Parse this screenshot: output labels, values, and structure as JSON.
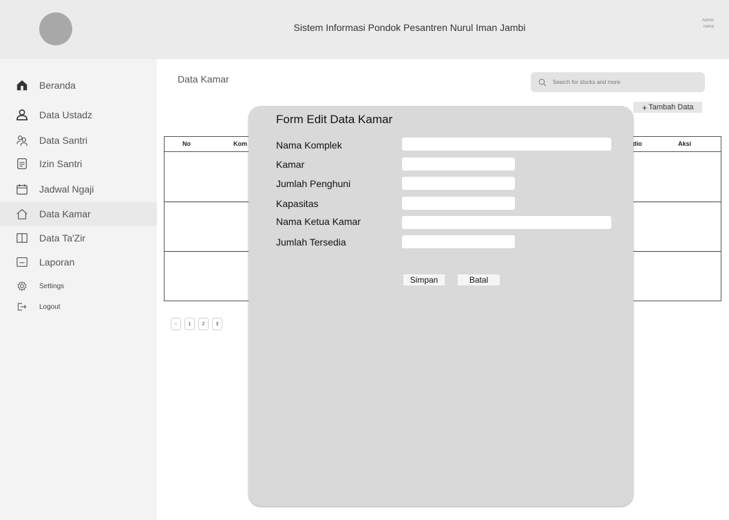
{
  "header": {
    "title": "Sistem Informasi Pondok Pesantren Nurul Iman Jambi",
    "admin_name": "Admin",
    "admin_sub": "nama"
  },
  "sidebar": {
    "items": [
      {
        "label": "Beranda",
        "icon": "home-icon"
      },
      {
        "label": "Data Ustadz",
        "icon": "user-icon"
      },
      {
        "label": "Data Santri",
        "icon": "users-icon"
      },
      {
        "label": "Izin Santri",
        "icon": "document-icon"
      },
      {
        "label": "Jadwal Ngaji",
        "icon": "calendar-icon"
      },
      {
        "label": "Data Kamar",
        "icon": "house-outline-icon"
      },
      {
        "label": "Data Ta'Zir",
        "icon": "book-icon"
      },
      {
        "label": "Laporan",
        "icon": "report-icon"
      },
      {
        "label": "Settings",
        "icon": "gear-icon"
      },
      {
        "label": "Logout",
        "icon": "logout-icon"
      }
    ]
  },
  "main": {
    "page_title": "Data Kamar",
    "search_placeholder": "Search for stocks and more",
    "add_button": "Tambah Data",
    "table": {
      "columns": [
        "No",
        "Kom",
        "dio",
        "Aksi"
      ]
    },
    "pagination": [
      "1",
      "2",
      "3"
    ]
  },
  "modal": {
    "title": "Form Edit Data Kamar",
    "fields": [
      {
        "label": "Nama Komplek",
        "value": ""
      },
      {
        "label": "Kamar",
        "value": ""
      },
      {
        "label": "Jumlah Penghuni",
        "value": ""
      },
      {
        "label": "Kapasitas",
        "value": ""
      },
      {
        "label": "Nama Ketua Kamar",
        "value": ""
      },
      {
        "label": "Jumlah Tersedia",
        "value": ""
      }
    ],
    "save_label": "Simpan",
    "cancel_label": "Batal"
  },
  "colors": {
    "header_bg": "#ebebeb",
    "sidebar_bg": "#f3f3f3",
    "modal_bg": "#d9d9d9",
    "active_item_bg": "#e9e9e9"
  }
}
